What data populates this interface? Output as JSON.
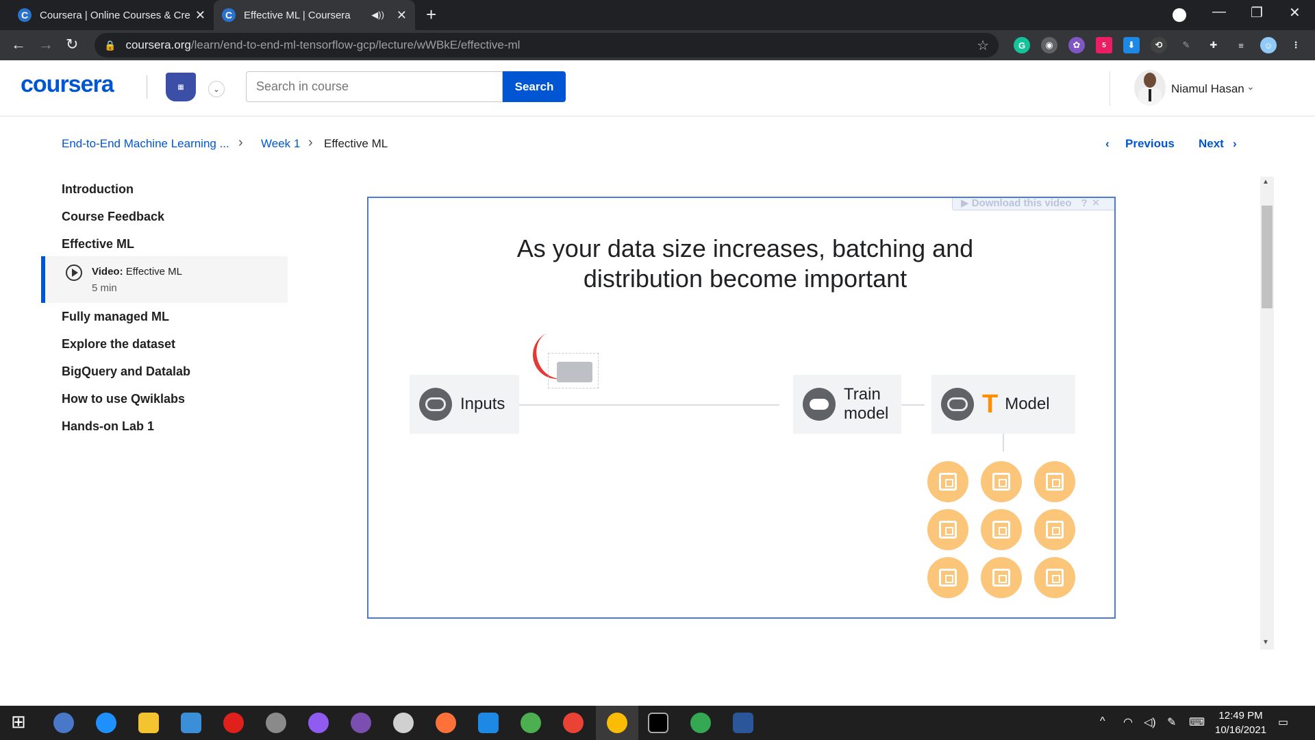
{
  "browser": {
    "tabs": [
      {
        "title": "Coursera | Online Courses & Cre",
        "favicon": "C",
        "active": false
      },
      {
        "title": "Effective ML | Coursera",
        "favicon": "C",
        "active": true
      }
    ],
    "url_host": "coursera.org",
    "url_path": "/learn/end-to-end-ml-tensorflow-gcp/lecture/wWBkE/effective-ml",
    "extension_badge": "5"
  },
  "header": {
    "logo": "coursera",
    "search_placeholder": "Search in course",
    "search_button": "Search",
    "user_name": "Niamul Hasan"
  },
  "breadcrumb": {
    "course": "End-to-End Machine Learning ...",
    "week": "Week 1",
    "current": "Effective ML"
  },
  "pager": {
    "previous": "Previous",
    "next": "Next"
  },
  "sidebar": {
    "items": [
      {
        "label": "Introduction"
      },
      {
        "label": "Course Feedback"
      },
      {
        "label": "Effective ML"
      },
      {
        "label": "Fully managed ML"
      },
      {
        "label": "Explore the dataset"
      },
      {
        "label": "BigQuery and Datalab"
      },
      {
        "label": "How to use Qwiklabs"
      },
      {
        "label": "Hands-on Lab 1"
      }
    ],
    "active_item": {
      "type_label": "Video:",
      "title": "Effective ML",
      "duration": "5 min"
    }
  },
  "video": {
    "download_bar": "▶ Download this video",
    "slide_title": "As your data size increases, batching and distribution become important",
    "nodes": {
      "inputs": "Inputs",
      "train_line1": "Train",
      "train_line2": "model",
      "model": "Model"
    }
  },
  "taskbar": {
    "time": "12:49 PM",
    "date": "10/16/2021"
  },
  "colors": {
    "brand": "#0056d2",
    "chip": "#fbc67a",
    "tensorflow": "#ff8f00"
  }
}
